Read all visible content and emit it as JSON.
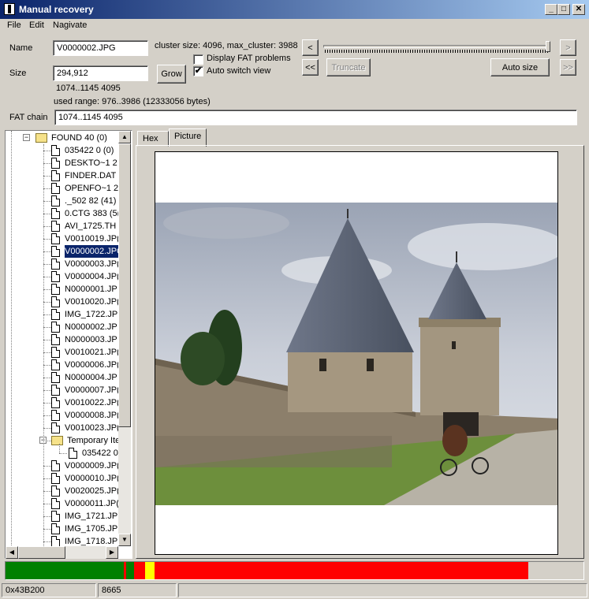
{
  "window": {
    "title": "Manual recovery",
    "min": "_",
    "max": "□",
    "close": "✕"
  },
  "menu": [
    "File",
    "Edit",
    "Nagivate"
  ],
  "form": {
    "name_label": "Name",
    "name_value": "V0000002.JPG",
    "size_label": "Size",
    "size_value": "294,912",
    "grow_label": "Grow",
    "cluster_info": "cluster size: 4096, max_cluster: 3988",
    "range_text": "1074..1145 4095",
    "used_range": "used range: 976..3986 (12333056 bytes)",
    "fat_chain_label": "FAT chain",
    "fat_chain_value": "1074..1145 4095",
    "display_fat_label": "Display FAT problems",
    "display_fat_checked": false,
    "auto_switch_label": "Auto switch view",
    "auto_switch_checked": true,
    "auto_switch_mark": "✔",
    "truncate_label": "Truncate",
    "auto_size_label": "Auto size",
    "nav_prev": "<",
    "nav_first": "<<",
    "nav_next": ">",
    "nav_last": ">>"
  },
  "tree": {
    "root_label": "FOUND 40 (0)",
    "root_expander": "−",
    "items": [
      "035422 0 (0)",
      "DESKTO~1 2",
      "FINDER.DAT",
      "OPENFO~1 2",
      "._502 82 (41)",
      "0.CTG 383 (5(",
      "AVI_1725.TH",
      "V0010019.JP(",
      "V0000002.JPG",
      "V0000003.JP(",
      "V0000004.JP(",
      "N0000001.JP",
      "V0010020.JP(",
      "IMG_1722.JP",
      "N0000002.JP",
      "N0000003.JP",
      "V0010021.JP(",
      "V0000006.JP(",
      "N0000004.JP",
      "V0000007.JP(",
      "V0010022.JP(",
      "V0000008.JP(",
      "V0010023.JP("
    ],
    "selected_index": 8,
    "temp_folder": "Temporary Ite",
    "temp_expander": "−",
    "temp_child": "035422 0",
    "items_after": [
      "V0000009.JP(",
      "V0000010.JP(",
      "V0020025.JP(",
      "V0000011.JP(",
      "IMG_1721.JP",
      "IMG_1705.JP",
      "IMG_1718.JP("
    ]
  },
  "tabs": [
    "Hex",
    "Picture"
  ],
  "active_tab": "Picture",
  "map": {
    "colors": {
      "green": "#008000",
      "red": "#ff0000",
      "yellow": "#ffff00"
    }
  },
  "status": {
    "offset": "0x43B200",
    "cluster": "8665"
  }
}
